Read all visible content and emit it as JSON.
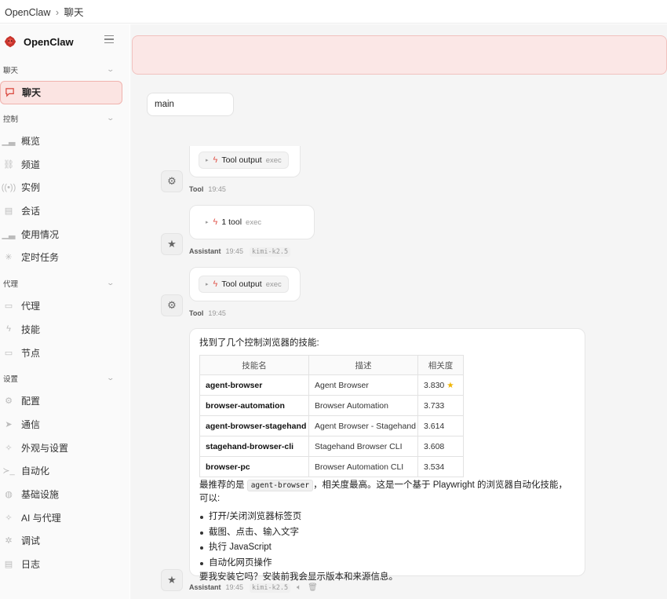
{
  "breadcrumb": {
    "app": "OpenClaw",
    "separator": "›",
    "page": "聊天"
  },
  "brand": {
    "name": "OpenClaw",
    "logo_icon": "claw-logo-icon",
    "menu_icon": "hamburger-icon",
    "accent_color": "#d9453b"
  },
  "sidebar": {
    "sections": [
      {
        "title": "聊天",
        "items": [
          {
            "label": "聊天",
            "icon": "chat-bubble-icon",
            "active": true
          }
        ]
      },
      {
        "title": "控制",
        "items": [
          {
            "label": "概览",
            "icon": "bar-chart-icon"
          },
          {
            "label": "频道",
            "icon": "link-icon"
          },
          {
            "label": "实例",
            "icon": "radio-icon"
          },
          {
            "label": "会话",
            "icon": "document-icon"
          },
          {
            "label": "使用情况",
            "icon": "bar-chart-icon"
          },
          {
            "label": "定时任务",
            "icon": "loader-icon"
          }
        ]
      },
      {
        "title": "代理",
        "items": [
          {
            "label": "代理",
            "icon": "folder-icon"
          },
          {
            "label": "技能",
            "icon": "bolt-icon"
          },
          {
            "label": "节点",
            "icon": "monitor-icon"
          }
        ]
      },
      {
        "title": "设置",
        "items": [
          {
            "label": "配置",
            "icon": "gear-icon"
          },
          {
            "label": "通信",
            "icon": "send-icon"
          },
          {
            "label": "外观与设置",
            "icon": "sparkle-icon"
          },
          {
            "label": "自动化",
            "icon": "terminal-icon"
          },
          {
            "label": "基础设施",
            "icon": "globe-icon"
          },
          {
            "label": "AI 与代理",
            "icon": "sparkle-icon"
          },
          {
            "label": "调试",
            "icon": "bug-icon"
          },
          {
            "label": "日志",
            "icon": "scroll-icon"
          }
        ]
      }
    ]
  },
  "session": {
    "value": "main"
  },
  "messages": {
    "tool1": {
      "pill_label": "Tool output",
      "pill_sub": "exec",
      "role": "Tool",
      "time": "19:45",
      "avatar_icon": "gear-icon"
    },
    "assistant1": {
      "pill_label": "1 tool",
      "pill_sub": "exec",
      "role": "Assistant",
      "time": "19:45",
      "model": "kimi-k2.5",
      "avatar_icon": "star-icon"
    },
    "tool2": {
      "pill_label": "Tool output",
      "pill_sub": "exec",
      "role": "Tool",
      "time": "19:45",
      "avatar_icon": "gear-icon"
    },
    "assistant2": {
      "intro": "找到了几个控制浏览器的技能:",
      "table": {
        "headers": [
          "技能名",
          "描述",
          "相关度"
        ],
        "rows": [
          {
            "name": "agent-browser",
            "desc": "Agent Browser",
            "score": "3.830",
            "starred": true
          },
          {
            "name": "browser-automation",
            "desc": "Browser Automation",
            "score": "3.733"
          },
          {
            "name": "agent-browser-stagehand",
            "desc": "Agent Browser - Stagehand",
            "score": "3.614"
          },
          {
            "name": "stagehand-browser-cli",
            "desc": "Stagehand Browser CLI",
            "score": "3.608"
          },
          {
            "name": "browser-pc",
            "desc": "Browser Automation CLI",
            "score": "3.534"
          }
        ]
      },
      "recommend_prefix": "最推荐的是",
      "recommend_code": "agent-browser",
      "recommend_suffix": "，相关度最高。这是一个基于 Playwright 的浏览器自动化技能，可以:",
      "bullets": [
        "打开/关闭浏览器标签页",
        "截图、点击、输入文字",
        "执行 JavaScript",
        "自动化网页操作"
      ],
      "question": "要我安装它吗？安装前我会显示版本和来源信息。",
      "role": "Assistant",
      "time": "19:45",
      "model": "kimi-k2.5",
      "avatar_icon": "star-icon",
      "actions": [
        "speaker-icon",
        "trash-icon"
      ]
    }
  }
}
